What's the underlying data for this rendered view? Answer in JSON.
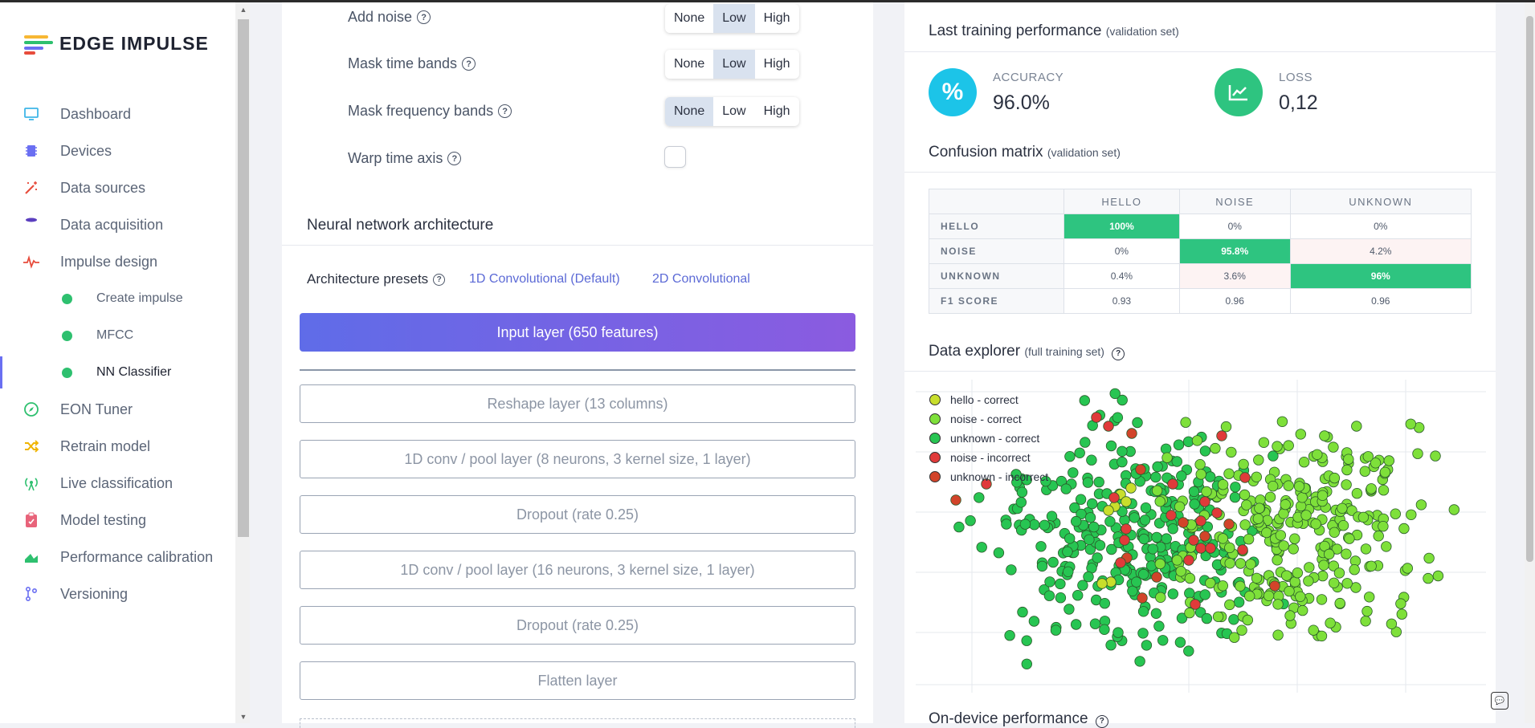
{
  "brand": {
    "name": "EDGE IMPULSE",
    "colors": [
      "#f7b733",
      "#2ec06f",
      "#6a6ff2",
      "#e74c3c"
    ]
  },
  "sidebar": {
    "items": [
      {
        "label": "Dashboard",
        "icon": "monitor-icon",
        "color": "#3fb6e8"
      },
      {
        "label": "Devices",
        "icon": "chip-icon",
        "color": "#6a6ff2"
      },
      {
        "label": "Data sources",
        "icon": "wand-icon",
        "color": "#e74c3c"
      },
      {
        "label": "Data acquisition",
        "icon": "database-icon",
        "color": "#5b3fbf"
      },
      {
        "label": "Impulse design",
        "icon": "pulse-icon",
        "color": "#e74c3c"
      },
      {
        "label": "Create impulse",
        "sub": true
      },
      {
        "label": "MFCC",
        "sub": true
      },
      {
        "label": "NN Classifier",
        "sub": true,
        "active": true
      },
      {
        "label": "EON Tuner",
        "icon": "compass-icon",
        "color": "#2ec06f"
      },
      {
        "label": "Retrain model",
        "icon": "shuffle-icon",
        "color": "#f0b400"
      },
      {
        "label": "Live classification",
        "icon": "broadcast-icon",
        "color": "#2ec06f"
      },
      {
        "label": "Model testing",
        "icon": "clipboard-icon",
        "color": "#e8637a"
      },
      {
        "label": "Performance calibration",
        "icon": "chart-area-icon",
        "color": "#2ec06f"
      },
      {
        "label": "Versioning",
        "icon": "branch-icon",
        "color": "#6a6ff2"
      }
    ]
  },
  "augmentation": {
    "add_noise": {
      "label": "Add noise",
      "selected": "Low"
    },
    "mask_time": {
      "label": "Mask time bands",
      "selected": "Low"
    },
    "mask_freq": {
      "label": "Mask frequency bands",
      "selected": "None"
    },
    "warp_time": {
      "label": "Warp time axis",
      "checked": false
    },
    "options": [
      "None",
      "Low",
      "High"
    ]
  },
  "architecture": {
    "title": "Neural network architecture",
    "presets_label": "Architecture presets",
    "preset_1d": "1D Convolutional (Default)",
    "preset_2d": "2D Convolutional",
    "input_layer": "Input layer (650 features)",
    "layers": [
      "Reshape layer (13 columns)",
      "1D conv / pool layer (8 neurons, 3 kernel size, 1 layer)",
      "Dropout (rate 0.25)",
      "1D conv / pool layer (16 neurons, 3 kernel size, 1 layer)",
      "Dropout (rate 0.25)",
      "Flatten layer"
    ]
  },
  "performance": {
    "title": "Last training performance",
    "subtitle": "(validation set)",
    "accuracy_label": "ACCURACY",
    "accuracy_value": "96.0%",
    "loss_label": "LOSS",
    "loss_value": "0,12"
  },
  "confusion": {
    "title": "Confusion matrix",
    "subtitle": "(validation set)",
    "columns": [
      "HELLO",
      "NOISE",
      "UNKNOWN"
    ],
    "rows": [
      {
        "label": "HELLO",
        "values": [
          "100%",
          "0%",
          "0%"
        ],
        "hi": 0
      },
      {
        "label": "NOISE",
        "values": [
          "0%",
          "95.8%",
          "4.2%"
        ],
        "hi": 1,
        "lo": 2
      },
      {
        "label": "UNKNOWN",
        "values": [
          "0.4%",
          "3.6%",
          "96%"
        ],
        "hi": 2,
        "lo": 1
      },
      {
        "label": "F1 SCORE",
        "values": [
          "0.93",
          "0.96",
          "0.96"
        ]
      }
    ]
  },
  "explorer": {
    "title": "Data explorer",
    "subtitle": "(full training set)",
    "legend": [
      {
        "label": "hello - correct",
        "color": "#c8de2c"
      },
      {
        "label": "noise - correct",
        "color": "#7ee03a"
      },
      {
        "label": "unknown - correct",
        "color": "#27c552"
      },
      {
        "label": "noise - incorrect",
        "color": "#e03a3a"
      },
      {
        "label": "unknown - incorrect",
        "color": "#d2442a"
      }
    ]
  },
  "on_device": {
    "title": "On-device performance"
  }
}
